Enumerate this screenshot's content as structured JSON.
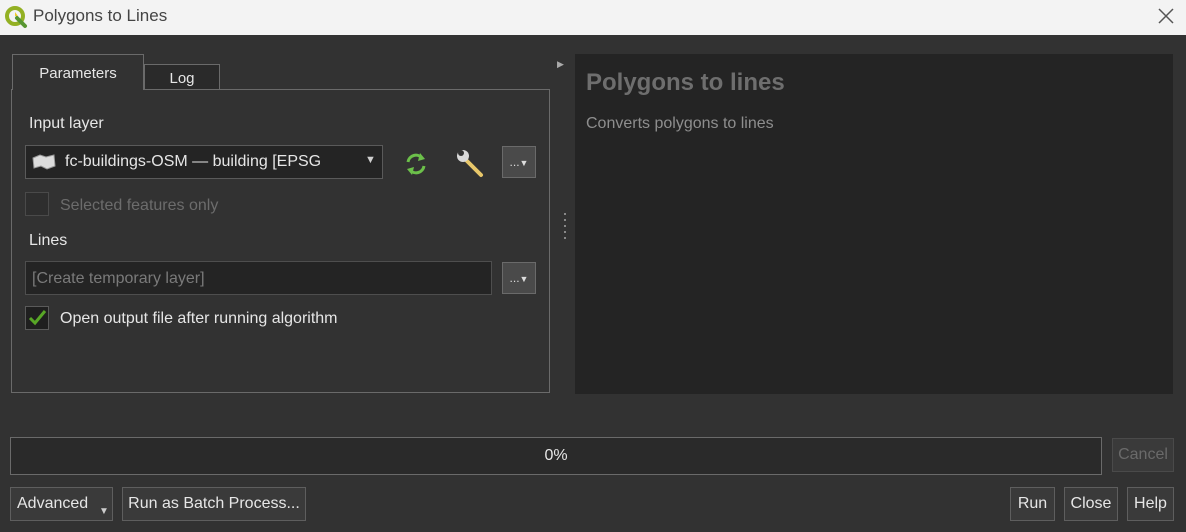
{
  "window": {
    "title": "Polygons to Lines"
  },
  "tabs": [
    {
      "label": "Parameters"
    },
    {
      "label": "Log"
    }
  ],
  "params": {
    "input_layer_label": "Input layer",
    "input_layer_value": "fc-buildings-OSM — building [EPSG",
    "more_label": "...",
    "selected_only_label": "Selected features only",
    "lines_label": "Lines",
    "lines_placeholder": "[Create temporary layer]",
    "open_output_label": "Open output file after running algorithm",
    "open_output_checked": true,
    "selected_only_checked": false
  },
  "help": {
    "title": "Polygons to lines",
    "description": "Converts polygons to lines"
  },
  "progress": {
    "text": "0%",
    "value": 0
  },
  "buttons": {
    "cancel": "Cancel",
    "advanced": "Advanced",
    "batch": "Run as Batch Process...",
    "run": "Run",
    "close": "Close",
    "help": "Help"
  },
  "colors": {
    "accent_green": "#58a626",
    "icon_green": "#6cc04a",
    "wrench": "#e8c76a"
  }
}
